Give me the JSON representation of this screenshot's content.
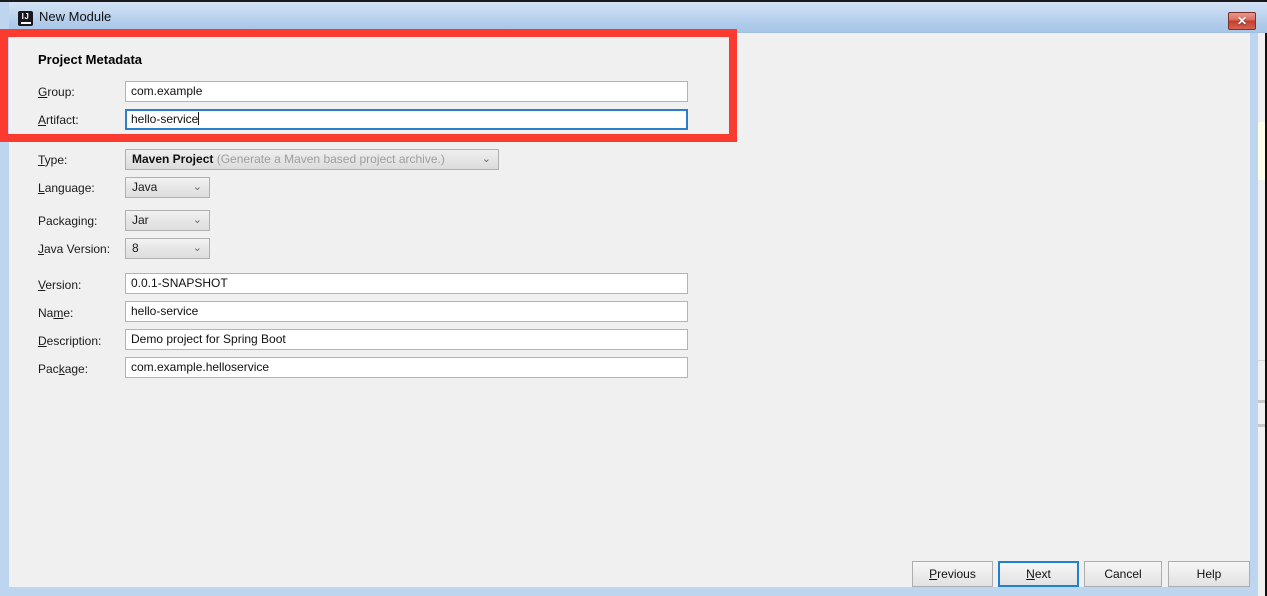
{
  "window": {
    "title": "New Module",
    "app_icon": "intellij-idea-icon",
    "close_label": "✕"
  },
  "colors": {
    "accent_focus": "#2a7ecb",
    "annotation_red": "#fb3b30",
    "titlebar_blue": "#b0cbea",
    "dialog_border": "#bdd5ee",
    "close_red": "#c23f2e"
  },
  "form": {
    "section_title": "Project Metadata",
    "fields": [
      {
        "name": "group",
        "label": "Group:",
        "mnemonic": "G",
        "value": "com.example",
        "type": "text",
        "focused": false
      },
      {
        "name": "artifact",
        "label": "Artifact:",
        "mnemonic": "A",
        "value": "hello-service",
        "type": "text",
        "focused": true
      },
      {
        "name": "type",
        "label": "Type:",
        "mnemonic": "T",
        "value": "Maven Project",
        "hint": "(Generate a Maven based project archive.)",
        "type": "combo",
        "disabled": true
      },
      {
        "name": "language",
        "label": "Language:",
        "mnemonic": "L",
        "value": "Java",
        "type": "combo"
      },
      {
        "name": "packaging",
        "label": "Packaging:",
        "mnemonic": "g",
        "value": "Jar",
        "type": "combo"
      },
      {
        "name": "java-version",
        "label": "Java Version:",
        "mnemonic": "J",
        "value": "8",
        "type": "combo"
      },
      {
        "name": "version",
        "label": "Version:",
        "mnemonic": "V",
        "value": "0.0.1-SNAPSHOT",
        "type": "text"
      },
      {
        "name": "project-name",
        "label": "Name:",
        "mnemonic": "m",
        "value": "hello-service",
        "type": "text"
      },
      {
        "name": "description",
        "label": "Description:",
        "mnemonic": "D",
        "value": "Demo project for Spring Boot",
        "type": "text"
      },
      {
        "name": "package",
        "label": "Package:",
        "mnemonic": "k",
        "value": "com.example.helloservice",
        "type": "text"
      }
    ]
  },
  "labels": {
    "group": {
      "pre": "G",
      "post": "roup:"
    },
    "artifact": {
      "pre": "A",
      "post": "rtifact:"
    },
    "type": {
      "pre": "T",
      "post": "ype:"
    },
    "language": {
      "pre": "L",
      "post": "anguage:"
    },
    "packaging": {
      "pre": "Packa",
      "mn": "g",
      "post": "ing:"
    },
    "javaversion": {
      "pre": "J",
      "post": "ava Version:"
    },
    "version": {
      "pre": "V",
      "post": "ersion:"
    },
    "name": {
      "pre": "Na",
      "mn": "m",
      "post": "e:"
    },
    "description": {
      "pre": "D",
      "post": "escription:"
    },
    "package": {
      "pre": "Pac",
      "mn": "k",
      "post": "age:"
    }
  },
  "combos": {
    "type_value": "Maven Project",
    "type_hint": "(Generate a Maven based project archive.)",
    "language_value": "Java",
    "packaging_value": "Jar",
    "javaversion_value": "8",
    "chevron": "⌄"
  },
  "values": {
    "group": "com.example",
    "artifact": "hello-service",
    "version": "0.0.1-SNAPSHOT",
    "name": "hello-service",
    "description": "Demo project for Spring Boot",
    "package": "com.example.helloservice"
  },
  "buttons": {
    "previous": {
      "pre": "",
      "mn": "P",
      "post": "revious"
    },
    "next": {
      "pre": "",
      "mn": "N",
      "post": "ext"
    },
    "cancel": "Cancel",
    "help": "Help"
  },
  "annotation": {
    "shape": "rectangle",
    "color": "#fb3b30",
    "highlights": [
      "Project Metadata",
      "Group:",
      "Artifact:"
    ]
  }
}
